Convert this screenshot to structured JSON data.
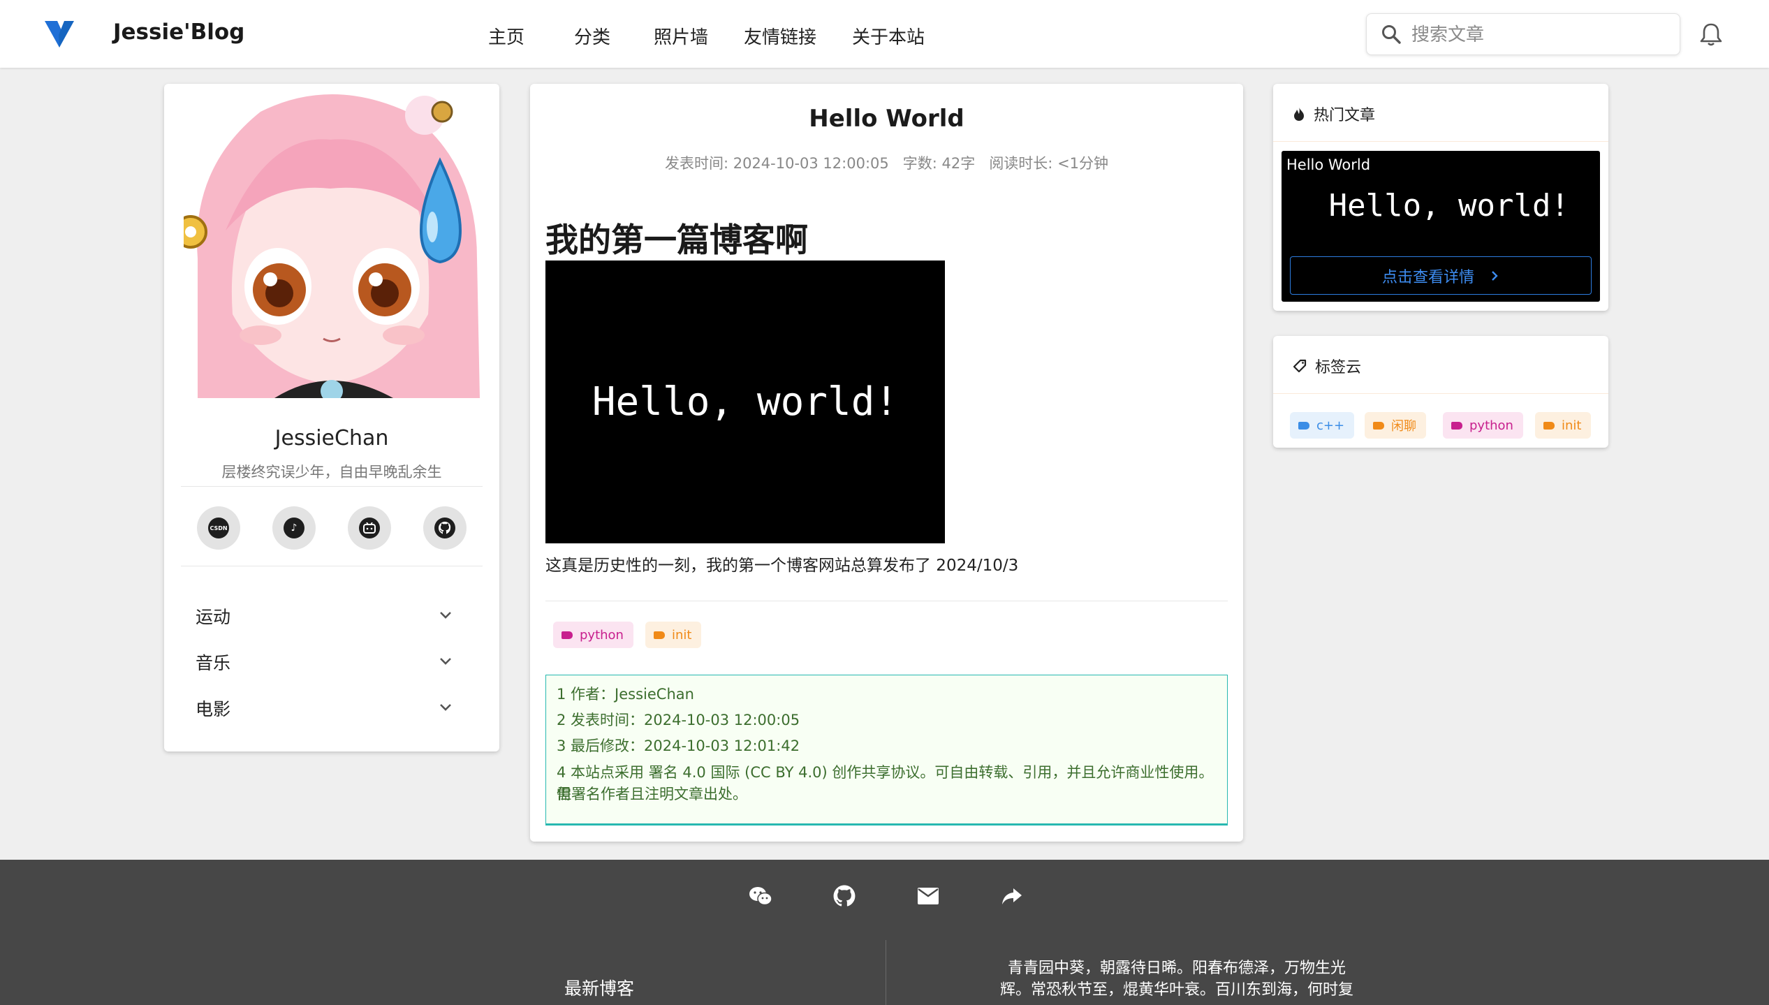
{
  "brand": {
    "name": "Jessie'Blog",
    "logo_icon": "vuetify-logo-icon"
  },
  "nav": {
    "items": [
      "主页",
      "分类",
      "照片墙",
      "友情链接",
      "关于本站"
    ]
  },
  "search": {
    "placeholder": "搜索文章"
  },
  "profile": {
    "name": "JessieChan",
    "motto": "层楼终究误少年，自由早晚乱余生",
    "socials": [
      "csdn-icon",
      "tiktok-icon",
      "bilibili-icon",
      "github-icon"
    ],
    "menu": [
      "运动",
      "音乐",
      "电影"
    ]
  },
  "post": {
    "title": "Hello World",
    "publish_label": "发表时间: 2024-10-03 12:00:05",
    "words_label": "字数: 42字",
    "read_label": "阅读时长: <1分钟",
    "heading": "我的第一篇博客啊",
    "image_text": "Hello, world!",
    "paragraph": "这真是历史性的一刻，我的第一个博客网站总算发布了 2024/10/3",
    "tags": [
      {
        "label": "python",
        "color": "#c8208e",
        "bg": "#fbe4f1"
      },
      {
        "label": "init",
        "color": "#f08a18",
        "bg": "#fdf0e0"
      }
    ],
    "copyright": [
      "1 作者：JessieChan",
      "2 发表时间：2024-10-03 12:00:05",
      "3 最后修改：2024-10-03 12:01:42",
      "4 本站点采用 署名 4.0 国际 (CC BY 4.0) 创作共享协议。可自由转载、引用，并且允许商业性使用。但",
      "需署名作者且注明文章出处。"
    ]
  },
  "hot": {
    "heading": "热门文章",
    "card_title": "Hello World",
    "card_image_text": "Hello, world!",
    "button": "点击查看详情"
  },
  "tagcloud": {
    "heading": "标签云",
    "tags": [
      {
        "label": "c++",
        "color": "#3b8de6",
        "bg": "#e6f1fc"
      },
      {
        "label": "闲聊",
        "color": "#f08a18",
        "bg": "#fdf0e0"
      },
      {
        "label": "python",
        "color": "#c8208e",
        "bg": "#fbe4f1"
      },
      {
        "label": "init",
        "color": "#f08a18",
        "bg": "#fdf0e0"
      }
    ]
  },
  "footer": {
    "icons": [
      "wechat-icon",
      "github-icon",
      "mail-icon",
      "share-icon"
    ],
    "recent_title": "最新博客",
    "poem_lines": [
      "青青园中葵，朝露待日晞。阳春布德泽，万物生光",
      "辉。常恐秋节至，焜黄华叶衰。百川东到海，何时复"
    ]
  },
  "colors": {
    "accent": "#2d7de0",
    "footer_bg": "#474747",
    "copyright_border": "#27b8b0"
  }
}
